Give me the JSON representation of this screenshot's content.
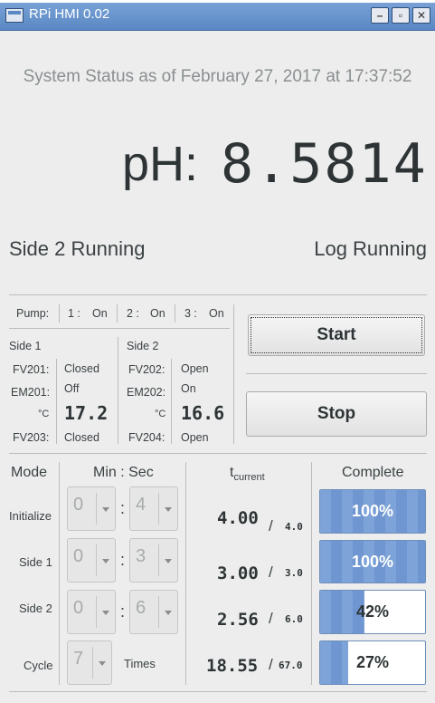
{
  "window": {
    "title": "RPi HMI 0.02",
    "minimize": "–",
    "restore": "▫",
    "close": "✕"
  },
  "status": {
    "header": "System Status as of February 27, 2017 at 17:37:52",
    "ph_label": "pH:",
    "ph_value": "8.5814",
    "side_running": "Side 2 Running",
    "log_running": "Log Running"
  },
  "pumps": {
    "label": "Pump:",
    "items": [
      {
        "name": "1 :",
        "state": "On"
      },
      {
        "name": "2 :",
        "state": "On"
      },
      {
        "name": "3 :",
        "state": "On"
      }
    ]
  },
  "side1": {
    "title": "Side 1",
    "rows": [
      {
        "label": "FV201:",
        "value": "Closed"
      },
      {
        "label": "EM201:",
        "value": "Off"
      },
      {
        "label": "°C",
        "value": "17.2"
      },
      {
        "label": "FV203:",
        "value": "Closed"
      }
    ]
  },
  "side2": {
    "title": "Side 2",
    "rows": [
      {
        "label": "FV202:",
        "value": "Open"
      },
      {
        "label": "EM202:",
        "value": "On"
      },
      {
        "label": "°C",
        "value": "16.6"
      },
      {
        "label": "FV204:",
        "value": "Open"
      }
    ]
  },
  "controls": {
    "start": "Start",
    "stop": "Stop"
  },
  "table": {
    "headers": {
      "mode": "Mode",
      "minsec": "Min : Sec",
      "t": "t",
      "t_sub": "current",
      "complete": "Complete"
    },
    "rows": [
      {
        "mode": "Initialize",
        "min": "0",
        "sec": "4",
        "current": "4.00",
        "total": "4.0",
        "percent": 100,
        "percent_text": "100%"
      },
      {
        "mode": "Side 1",
        "min": "0",
        "sec": "3",
        "current": "3.00",
        "total": "3.0",
        "percent": 100,
        "percent_text": "100%"
      },
      {
        "mode": "Side 2",
        "min": "0",
        "sec": "6",
        "current": "2.56",
        "total": "6.0",
        "percent": 42,
        "percent_text": "42%"
      },
      {
        "mode": "Cycle",
        "min": "7",
        "sec": "",
        "current": "18.55",
        "total": "67.0",
        "percent": 27,
        "percent_text": "27%"
      }
    ],
    "cycle_unit": "Times",
    "colon": ":",
    "slash": "/"
  },
  "colors": {
    "titlebar": "#5b88c4",
    "progress_fill": "#7ea3d9",
    "progress_border": "#6d8fb9"
  }
}
